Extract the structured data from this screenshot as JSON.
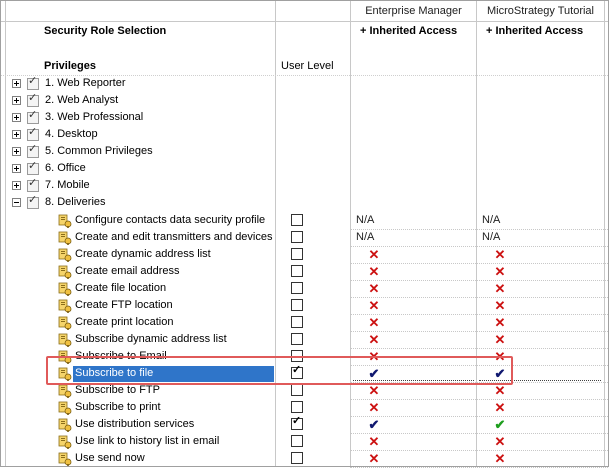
{
  "columns": {
    "enterprise_manager": "Enterprise Manager",
    "microstrategy_tutorial": "MicroStrategy Tutorial",
    "inherited_access_em": "+ Inherited Access",
    "inherited_access_mt": "+ Inherited Access",
    "user_level": "User Level"
  },
  "section_title": "Security Role Selection",
  "privileges_label": "Privileges",
  "groups": [
    {
      "label": "1. Web Reporter",
      "expanded": false
    },
    {
      "label": "2. Web Analyst",
      "expanded": false
    },
    {
      "label": "3. Web Professional",
      "expanded": false
    },
    {
      "label": "4. Desktop",
      "expanded": false
    },
    {
      "label": "5. Common Privileges",
      "expanded": false
    },
    {
      "label": "6. Office",
      "expanded": false
    },
    {
      "label": "7. Mobile",
      "expanded": false
    },
    {
      "label": "8. Deliveries",
      "expanded": true
    }
  ],
  "deliveries": [
    {
      "label": "Configure contacts data security profile",
      "user": false,
      "em": "N/A",
      "mt": "N/A"
    },
    {
      "label": "Create and edit transmitters and devices",
      "user": false,
      "em": "N/A",
      "mt": "N/A"
    },
    {
      "label": "Create dynamic address list",
      "user": false,
      "em": "x",
      "mt": "x"
    },
    {
      "label": "Create email address",
      "user": false,
      "em": "x",
      "mt": "x"
    },
    {
      "label": "Create file location",
      "user": false,
      "em": "x",
      "mt": "x"
    },
    {
      "label": "Create FTP location",
      "user": false,
      "em": "x",
      "mt": "x"
    },
    {
      "label": "Create print location",
      "user": false,
      "em": "x",
      "mt": "x"
    },
    {
      "label": "Subscribe dynamic address list",
      "user": false,
      "em": "x",
      "mt": "x"
    },
    {
      "label": "Subscribe to Email",
      "user": false,
      "em": "x",
      "mt": "x"
    },
    {
      "label": "Subscribe to file",
      "user": true,
      "em": "check",
      "mt": "check",
      "selected": true
    },
    {
      "label": "Subscribe to FTP",
      "user": false,
      "em": "x",
      "mt": "x"
    },
    {
      "label": "Subscribe to print",
      "user": false,
      "em": "x",
      "mt": "x"
    },
    {
      "label": "Use distribution services",
      "user": true,
      "em": "check",
      "mt": "check-green"
    },
    {
      "label": "Use link to history list in email",
      "user": false,
      "em": "x",
      "mt": "x"
    },
    {
      "label": "Use send now",
      "user": false,
      "em": "x",
      "mt": "x"
    }
  ],
  "colors": {
    "selection": "#2f75c9",
    "highlight_box": "#e05a5a",
    "deny": "#cc1010",
    "grant": "#101870",
    "inherited_grant": "#1e9e1e"
  },
  "icons": {
    "collapse": "minus-box-icon",
    "expand": "plus-box-icon",
    "privilege": "privilege-key-icon",
    "deny": "red-x-icon",
    "grant": "check-icon"
  }
}
